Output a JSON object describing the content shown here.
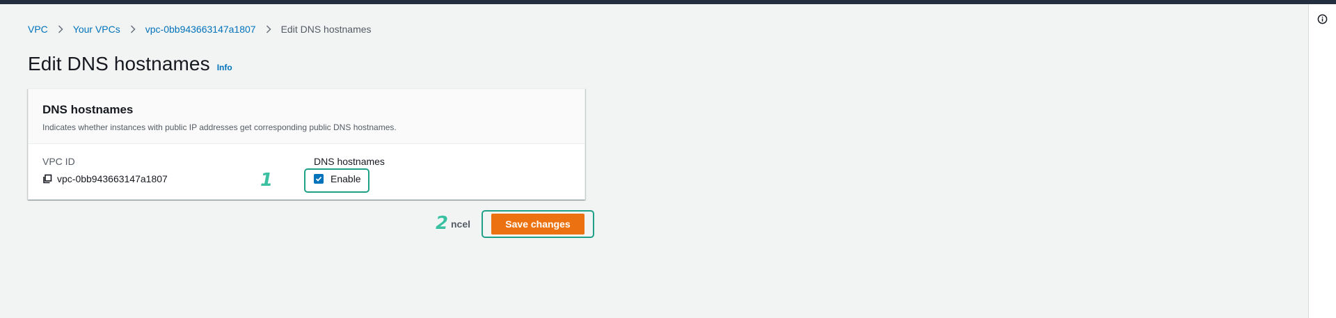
{
  "breadcrumb": {
    "items": [
      "VPC",
      "Your VPCs",
      "vpc-0bb943663147a1807"
    ],
    "current": "Edit DNS hostnames"
  },
  "page": {
    "title": "Edit DNS hostnames",
    "info_link": "Info"
  },
  "panel": {
    "title": "DNS hostnames",
    "description": "Indicates whether instances with public IP addresses get corresponding public DNS hostnames.",
    "vpc_id_label": "VPC ID",
    "vpc_id_value": "vpc-0bb943663147a1807",
    "dns_label": "DNS hostnames",
    "enable_label": "Enable",
    "enable_checked": true
  },
  "actions": {
    "cancel_label": "ncel",
    "save_label": "Save changes"
  },
  "annotations": {
    "step1": "1",
    "step2": "2"
  },
  "colors": {
    "accent": "#0073bb",
    "primary_button": "#ec7211",
    "annotation": "#1ea087"
  },
  "icons": {
    "help": "info-circle-icon",
    "separator": "chevron-right-icon",
    "copy": "copy-icon",
    "checkbox": "checkmark-icon"
  }
}
